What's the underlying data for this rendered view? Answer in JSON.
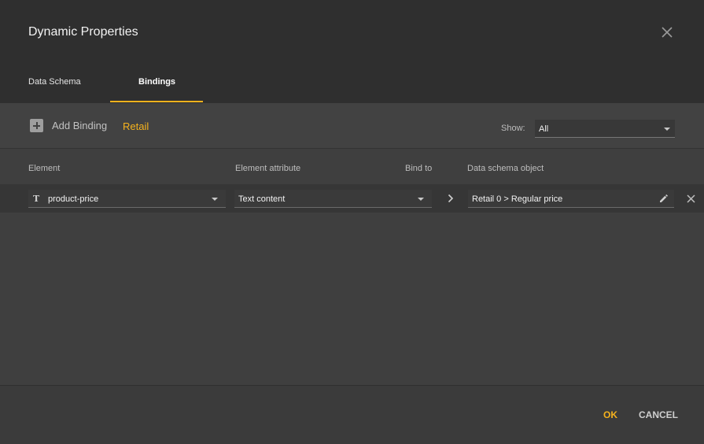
{
  "dialog": {
    "title": "Dynamic Properties",
    "close_icon": "close-icon"
  },
  "tabs": [
    {
      "label": "Data Schema",
      "active": false
    },
    {
      "label": "Bindings",
      "active": true
    }
  ],
  "toolbar": {
    "add_binding_label": "Add Binding",
    "add_icon": "add-box-icon",
    "schema_name": "Retail",
    "show_label": "Show:",
    "show_value": "All"
  },
  "table": {
    "headers": [
      "Element",
      "Element attribute",
      "Bind to",
      "Data schema object"
    ],
    "rows": [
      {
        "element_type_icon": "T",
        "element": "product-price",
        "attribute": "Text content",
        "schema_object": "Retail 0 > Regular price"
      }
    ]
  },
  "footer": {
    "ok_label": "OK",
    "cancel_label": "CANCEL"
  },
  "colors": {
    "accent": "#f5b21d",
    "header_bg": "#2f2f2f",
    "body_bg": "#3f3f3f"
  }
}
